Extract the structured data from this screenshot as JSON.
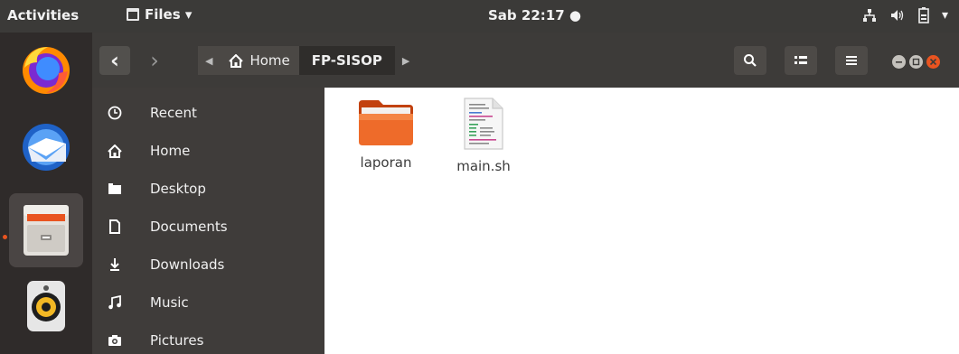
{
  "topbar": {
    "activities": "Activities",
    "app_name": "Files ▾",
    "clock": "Sab 22:17 ●",
    "tray": {
      "network": "network-icon",
      "volume": "volume-icon",
      "battery": "battery-icon",
      "menu_arrow": "▾"
    }
  },
  "dock": [
    {
      "name": "firefox-icon"
    },
    {
      "name": "thunderbird-icon"
    },
    {
      "name": "files-icon",
      "active": true
    },
    {
      "name": "rhythmbox-icon"
    }
  ],
  "headerbar": {
    "back": "‹",
    "forward": "›",
    "path": [
      {
        "label": "Home",
        "icon": "home-icon"
      },
      {
        "label": "FP-SISOP",
        "current": true
      }
    ],
    "search": "search-icon",
    "view": "view-toggle-icon",
    "menu": "menu-icon"
  },
  "sidebar": {
    "items": [
      {
        "label": "Recent",
        "icon": "recent-icon"
      },
      {
        "label": "Home",
        "icon": "home-icon"
      },
      {
        "label": "Desktop",
        "icon": "desktop-icon"
      },
      {
        "label": "Documents",
        "icon": "documents-icon"
      },
      {
        "label": "Downloads",
        "icon": "downloads-icon"
      },
      {
        "label": "Music",
        "icon": "music-icon"
      },
      {
        "label": "Pictures",
        "icon": "pictures-icon"
      }
    ]
  },
  "files": [
    {
      "name": "laporan",
      "type": "folder"
    },
    {
      "name": "main.sh",
      "type": "script"
    }
  ],
  "colors": {
    "accent": "#e95420",
    "panel": "#3b3a38",
    "sidebar": "#3f3c3a"
  }
}
